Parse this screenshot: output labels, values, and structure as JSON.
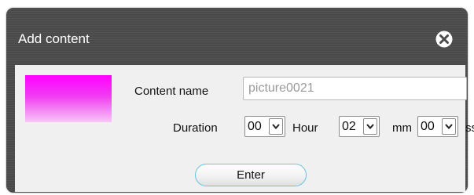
{
  "dialog": {
    "title": "Add content",
    "close_icon": "close-circle-icon"
  },
  "colors": {
    "dialog_bg": "#4a4a4a",
    "panel_bg": "#f0f0f0",
    "preview_top": "#ff00ff",
    "preview_bottom": "#f7c6f7",
    "button_border": "#6cc1dc"
  },
  "content_name": {
    "label": "Content name",
    "value": "picture0021"
  },
  "duration": {
    "label": "Duration",
    "hour": {
      "value": "00",
      "unit": "Hour"
    },
    "minute": {
      "value": "02",
      "unit": "mm"
    },
    "second": {
      "value": "00",
      "unit": "ss"
    },
    "arrow_icon": "chevron-down-icon"
  },
  "enter_button": {
    "label": "Enter"
  }
}
